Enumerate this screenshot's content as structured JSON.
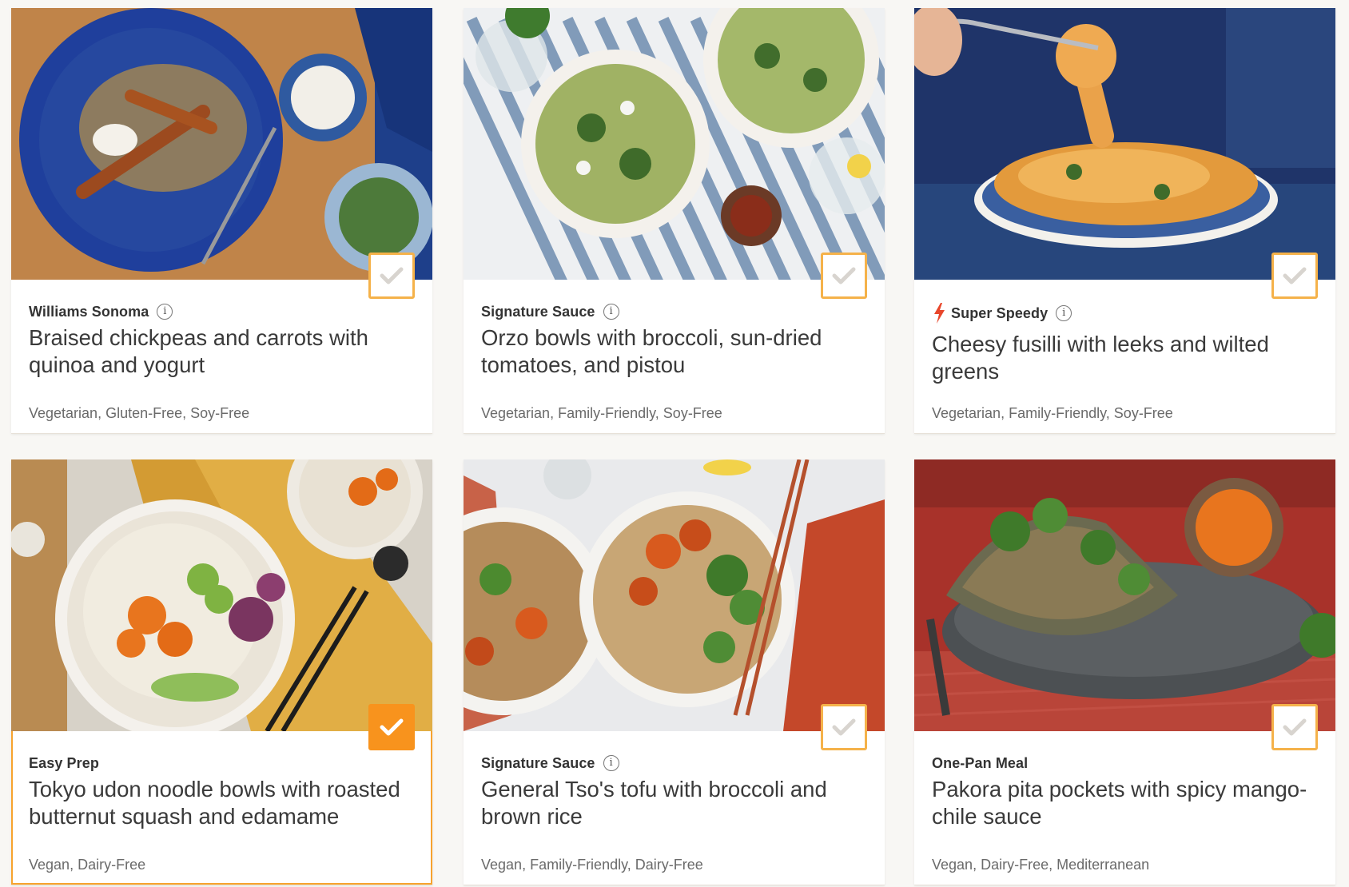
{
  "meals": [
    {
      "badge": "Williams Sonoma",
      "title": "Braised chickpeas and carrots with quinoa and yogurt",
      "tags": [
        "Vegetarian",
        "Gluten-Free",
        "Soy-Free"
      ],
      "selected": false
    },
    {
      "badge": "Signature Sauce",
      "title": "Orzo bowls with broccoli, sun-dried tomatoes, and pistou",
      "tags": [
        "Vegetarian",
        "Family-Friendly",
        "Soy-Free"
      ],
      "selected": false
    },
    {
      "badge": "Super Speedy",
      "title": "Cheesy fusilli with leeks and wilted greens",
      "tags": [
        "Vegetarian",
        "Family-Friendly",
        "Soy-Free"
      ],
      "selected": false
    },
    {
      "badge": "Easy Prep",
      "title": "Tokyo udon noodle bowls with roasted butternut squash and edamame",
      "tags": [
        "Vegan",
        "Dairy-Free"
      ],
      "selected": true
    },
    {
      "badge": "Signature Sauce",
      "title": "General Tso's tofu with broccoli and brown rice",
      "tags": [
        "Vegan",
        "Family-Friendly",
        "Dairy-Free"
      ],
      "selected": false
    },
    {
      "badge": "One-Pan Meal",
      "title": "Pakora pita pockets with spicy mango-chile sauce",
      "tags": [
        "Vegan",
        "Dairy-Free",
        "Mediterranean"
      ],
      "selected": false
    }
  ],
  "info_glyph": "i",
  "colors": {
    "accent": "#f8931d",
    "check_border": "#f5b24a",
    "bolt": "#e8462b"
  }
}
